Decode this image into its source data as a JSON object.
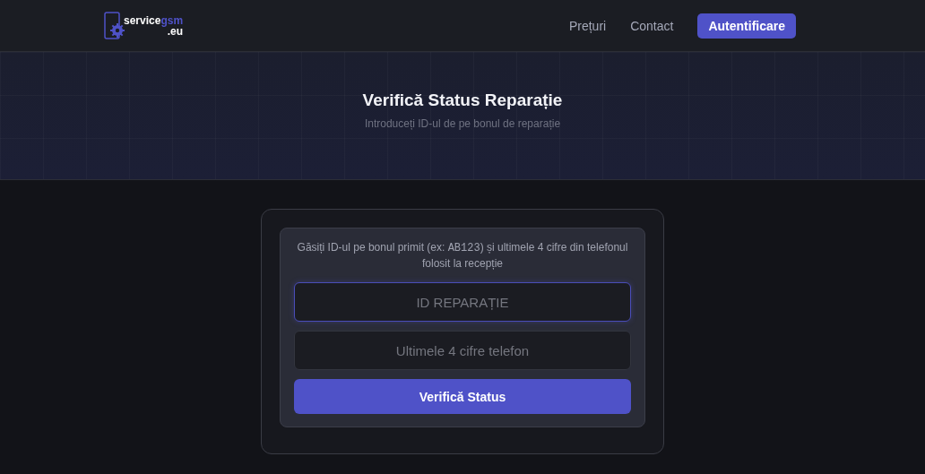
{
  "header": {
    "logo": {
      "name": "service",
      "accent": "gsm",
      "domain": ".eu"
    },
    "nav": [
      {
        "label": "Prețuri",
        "kind": "link"
      },
      {
        "label": "Contact",
        "kind": "link"
      },
      {
        "label": "Autentificare",
        "kind": "button"
      }
    ]
  },
  "hero": {
    "title": "Verifică Status Reparație",
    "subtitle": "Introduceți ID-ul de pe bonul de reparație"
  },
  "form": {
    "hint": {
      "before": "Găsiți ID-ul pe bonul primit (ex: ",
      "code": "AB123",
      "after": ") și ultimele 4 cifre din telefonul folosit la recepție"
    },
    "fields": [
      {
        "placeholder": "ID REPARAȚIE",
        "focused": true
      },
      {
        "placeholder": "Ultimele 4 cifre telefon",
        "focused": false
      }
    ],
    "submit": "Verifică Status"
  }
}
